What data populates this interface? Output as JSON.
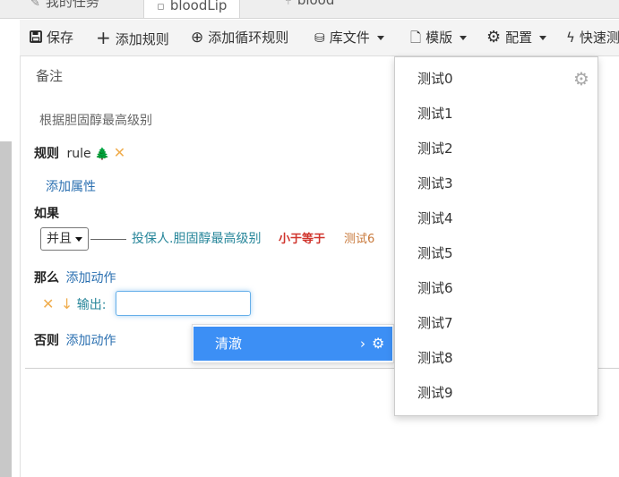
{
  "tabs": [
    {
      "label": "我的任务",
      "icon": "edit-icon"
    },
    {
      "label": "bloodLip",
      "icon": "file-icon"
    },
    {
      "label": "blood",
      "icon": "branch-icon"
    }
  ],
  "toolbar": {
    "save": "保存",
    "add_rule": "添加规则",
    "add_loop_rule": "添加循环规则",
    "library": "库文件",
    "template": "模版",
    "config": "配置",
    "quick": "快速测"
  },
  "editor": {
    "remark_label": "备注",
    "remark_text": "根据胆固醇最高级别",
    "rule_label": "规则",
    "rule_name": "rule",
    "add_property": "添加属性",
    "if_label": "如果",
    "join_select": "并且",
    "condition": {
      "left": "投保人.胆固醇最高级别",
      "op": "小于等于",
      "right": "测试6"
    },
    "then_label": "那么",
    "add_action": "添加动作",
    "output_label": "输出:",
    "output_value": "",
    "else_label": "否则",
    "else_add_action": "添加动作"
  },
  "context_menu": {
    "item": "清澈"
  },
  "dropdown": {
    "items": [
      "测试0",
      "测试1",
      "测试2",
      "测试3",
      "测试4",
      "测试5",
      "测试6",
      "测试7",
      "测试8",
      "测试9"
    ]
  },
  "colors": {
    "accent": "#3c8ff5",
    "link": "#2a6fb0",
    "operator": "#d0342c",
    "value": "#c8783a",
    "variable": "#27869a",
    "delete": "#f0ad4e"
  }
}
